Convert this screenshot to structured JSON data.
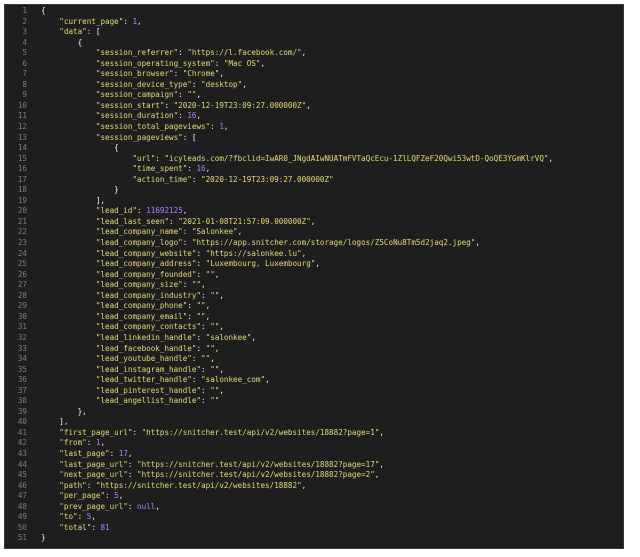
{
  "editor": {
    "lines": [
      [
        [
          "p",
          "{"
        ]
      ],
      [
        [
          "p",
          "    "
        ],
        [
          "k",
          "\"current_page\""
        ],
        [
          "p",
          ": "
        ],
        [
          "n",
          "1"
        ],
        [
          "p",
          ","
        ]
      ],
      [
        [
          "p",
          "    "
        ],
        [
          "k",
          "\"data\""
        ],
        [
          "p",
          ": ["
        ]
      ],
      [
        [
          "p",
          "        {"
        ]
      ],
      [
        [
          "p",
          "            "
        ],
        [
          "k",
          "\"session_referrer\""
        ],
        [
          "p",
          ": "
        ],
        [
          "s",
          "\"https://l.facebook.com/\""
        ],
        [
          "p",
          ","
        ]
      ],
      [
        [
          "p",
          "            "
        ],
        [
          "k",
          "\"session_operating_system\""
        ],
        [
          "p",
          ": "
        ],
        [
          "s",
          "\"Mac OS\""
        ],
        [
          "p",
          ","
        ]
      ],
      [
        [
          "p",
          "            "
        ],
        [
          "k",
          "\"session_browser\""
        ],
        [
          "p",
          ": "
        ],
        [
          "s",
          "\"Chrome\""
        ],
        [
          "p",
          ","
        ]
      ],
      [
        [
          "p",
          "            "
        ],
        [
          "k",
          "\"session_device_type\""
        ],
        [
          "p",
          ": "
        ],
        [
          "s",
          "\"desktop\""
        ],
        [
          "p",
          ","
        ]
      ],
      [
        [
          "p",
          "            "
        ],
        [
          "k",
          "\"session_campaign\""
        ],
        [
          "p",
          ": "
        ],
        [
          "s",
          "\"\""
        ],
        [
          "p",
          ","
        ]
      ],
      [
        [
          "p",
          "            "
        ],
        [
          "k",
          "\"session_start\""
        ],
        [
          "p",
          ": "
        ],
        [
          "s",
          "\"2020-12-19T23:09:27.000000Z\""
        ],
        [
          "p",
          ","
        ]
      ],
      [
        [
          "p",
          "            "
        ],
        [
          "k",
          "\"session_duration\""
        ],
        [
          "p",
          ": "
        ],
        [
          "n",
          "16"
        ],
        [
          "p",
          ","
        ]
      ],
      [
        [
          "p",
          "            "
        ],
        [
          "k",
          "\"session_total_pageviews\""
        ],
        [
          "p",
          ": "
        ],
        [
          "n",
          "1"
        ],
        [
          "p",
          ","
        ]
      ],
      [
        [
          "p",
          "            "
        ],
        [
          "k",
          "\"session_pageviews\""
        ],
        [
          "p",
          ": ["
        ]
      ],
      [
        [
          "p",
          "                {"
        ]
      ],
      [
        [
          "p",
          "                    "
        ],
        [
          "k",
          "\"url\""
        ],
        [
          "p",
          ": "
        ],
        [
          "s",
          "\"icyleads.com/?fbclid=IwAR0_JNgdAIwNUATmFVTaQcEcu-1ZlLQFZeF20Qwi53wtD-QoQE3YGmKlrVQ\""
        ],
        [
          "p",
          ","
        ]
      ],
      [
        [
          "p",
          "                    "
        ],
        [
          "k",
          "\"time_spent\""
        ],
        [
          "p",
          ": "
        ],
        [
          "n",
          "16"
        ],
        [
          "p",
          ","
        ]
      ],
      [
        [
          "p",
          "                    "
        ],
        [
          "k",
          "\"action_time\""
        ],
        [
          "p",
          ": "
        ],
        [
          "s",
          "\"2020-12-19T23:09:27.000000Z\""
        ]
      ],
      [
        [
          "p",
          "                }"
        ]
      ],
      [
        [
          "p",
          "            ],"
        ]
      ],
      [
        [
          "p",
          "            "
        ],
        [
          "k",
          "\"lead_id\""
        ],
        [
          "p",
          ": "
        ],
        [
          "n",
          "11692125"
        ],
        [
          "p",
          ","
        ]
      ],
      [
        [
          "p",
          "            "
        ],
        [
          "k",
          "\"lead_last_seen\""
        ],
        [
          "p",
          ": "
        ],
        [
          "s",
          "\"2021-01-08T21:57:09.000000Z\""
        ],
        [
          "p",
          ","
        ]
      ],
      [
        [
          "p",
          "            "
        ],
        [
          "k",
          "\"lead_company_name\""
        ],
        [
          "p",
          ": "
        ],
        [
          "s",
          "\"Salonkee\""
        ],
        [
          "p",
          ","
        ]
      ],
      [
        [
          "p",
          "            "
        ],
        [
          "k",
          "\"lead_company_logo\""
        ],
        [
          "p",
          ": "
        ],
        [
          "s",
          "\"https://app.snitcher.com/storage/logos/Z5CoNu8Tm5d2jaq2.jpeg\""
        ],
        [
          "p",
          ","
        ]
      ],
      [
        [
          "p",
          "            "
        ],
        [
          "k",
          "\"lead_company_website\""
        ],
        [
          "p",
          ": "
        ],
        [
          "s",
          "\"https://salonkee.lu\""
        ],
        [
          "p",
          ","
        ]
      ],
      [
        [
          "p",
          "            "
        ],
        [
          "k",
          "\"lead_company_address\""
        ],
        [
          "p",
          ": "
        ],
        [
          "s",
          "\"Luxembourg, Luxembourg\""
        ],
        [
          "p",
          ","
        ]
      ],
      [
        [
          "p",
          "            "
        ],
        [
          "k",
          "\"lead_company_founded\""
        ],
        [
          "p",
          ": "
        ],
        [
          "s",
          "\"\""
        ],
        [
          "p",
          ","
        ]
      ],
      [
        [
          "p",
          "            "
        ],
        [
          "k",
          "\"lead_company_size\""
        ],
        [
          "p",
          ": "
        ],
        [
          "s",
          "\"\""
        ],
        [
          "p",
          ","
        ]
      ],
      [
        [
          "p",
          "            "
        ],
        [
          "k",
          "\"lead_company_industry\""
        ],
        [
          "p",
          ": "
        ],
        [
          "s",
          "\"\""
        ],
        [
          "p",
          ","
        ]
      ],
      [
        [
          "p",
          "            "
        ],
        [
          "k",
          "\"lead_company_phone\""
        ],
        [
          "p",
          ": "
        ],
        [
          "s",
          "\"\""
        ],
        [
          "p",
          ","
        ]
      ],
      [
        [
          "p",
          "            "
        ],
        [
          "k",
          "\"lead_company_email\""
        ],
        [
          "p",
          ": "
        ],
        [
          "s",
          "\"\""
        ],
        [
          "p",
          ","
        ]
      ],
      [
        [
          "p",
          "            "
        ],
        [
          "k",
          "\"lead_company_contacts\""
        ],
        [
          "p",
          ": "
        ],
        [
          "s",
          "\"\""
        ],
        [
          "p",
          ","
        ]
      ],
      [
        [
          "p",
          "            "
        ],
        [
          "k",
          "\"lead_linkedin_handle\""
        ],
        [
          "p",
          ": "
        ],
        [
          "s",
          "\"salonkee\""
        ],
        [
          "p",
          ","
        ]
      ],
      [
        [
          "p",
          "            "
        ],
        [
          "k",
          "\"lead_facebook_handle\""
        ],
        [
          "p",
          ": "
        ],
        [
          "s",
          "\"\""
        ],
        [
          "p",
          ","
        ]
      ],
      [
        [
          "p",
          "            "
        ],
        [
          "k",
          "\"lead_youtube_handle\""
        ],
        [
          "p",
          ": "
        ],
        [
          "s",
          "\"\""
        ],
        [
          "p",
          ","
        ]
      ],
      [
        [
          "p",
          "            "
        ],
        [
          "k",
          "\"lead_instagram_handle\""
        ],
        [
          "p",
          ": "
        ],
        [
          "s",
          "\"\""
        ],
        [
          "p",
          ","
        ]
      ],
      [
        [
          "p",
          "            "
        ],
        [
          "k",
          "\"lead_twitter_handle\""
        ],
        [
          "p",
          ": "
        ],
        [
          "s",
          "\"salonkee_com\""
        ],
        [
          "p",
          ","
        ]
      ],
      [
        [
          "p",
          "            "
        ],
        [
          "k",
          "\"lead_pinterest_handle\""
        ],
        [
          "p",
          ": "
        ],
        [
          "s",
          "\"\""
        ],
        [
          "p",
          ","
        ]
      ],
      [
        [
          "p",
          "            "
        ],
        [
          "k",
          "\"lead_angellist_handle\""
        ],
        [
          "p",
          ": "
        ],
        [
          "s",
          "\"\""
        ]
      ],
      [
        [
          "p",
          "        },"
        ]
      ],
      [
        [
          "p",
          "    ],"
        ]
      ],
      [
        [
          "p",
          "    "
        ],
        [
          "k",
          "\"first_page_url\""
        ],
        [
          "p",
          ": "
        ],
        [
          "s",
          "\"https://snitcher.test/api/v2/websites/18882?page=1\""
        ],
        [
          "p",
          ","
        ]
      ],
      [
        [
          "p",
          "    "
        ],
        [
          "k",
          "\"from\""
        ],
        [
          "p",
          ": "
        ],
        [
          "n",
          "1"
        ],
        [
          "p",
          ","
        ]
      ],
      [
        [
          "p",
          "    "
        ],
        [
          "k",
          "\"last_page\""
        ],
        [
          "p",
          ": "
        ],
        [
          "n",
          "17"
        ],
        [
          "p",
          ","
        ]
      ],
      [
        [
          "p",
          "    "
        ],
        [
          "k",
          "\"last_page_url\""
        ],
        [
          "p",
          ": "
        ],
        [
          "s",
          "\"https://snitcher.test/api/v2/websites/18882?page=17\""
        ],
        [
          "p",
          ","
        ]
      ],
      [
        [
          "p",
          "    "
        ],
        [
          "k",
          "\"next_page_url\""
        ],
        [
          "p",
          ": "
        ],
        [
          "s",
          "\"https://snitcher.test/api/v2/websites/18882?page=2\""
        ],
        [
          "p",
          ","
        ]
      ],
      [
        [
          "p",
          "    "
        ],
        [
          "k",
          "\"path\""
        ],
        [
          "p",
          ": "
        ],
        [
          "s",
          "\"https://snitcher.test/api/v2/websites/18882\""
        ],
        [
          "p",
          ","
        ]
      ],
      [
        [
          "p",
          "    "
        ],
        [
          "k",
          "\"per_page\""
        ],
        [
          "p",
          ": "
        ],
        [
          "n",
          "5"
        ],
        [
          "p",
          ","
        ]
      ],
      [
        [
          "p",
          "    "
        ],
        [
          "k",
          "\"prev_page_url\""
        ],
        [
          "p",
          ": "
        ],
        [
          "l",
          "null"
        ],
        [
          "p",
          ","
        ]
      ],
      [
        [
          "p",
          "    "
        ],
        [
          "k",
          "\"to\""
        ],
        [
          "p",
          ": "
        ],
        [
          "n",
          "5"
        ],
        [
          "p",
          ","
        ]
      ],
      [
        [
          "p",
          "    "
        ],
        [
          "k",
          "\"total\""
        ],
        [
          "p",
          ": "
        ],
        [
          "n",
          "81"
        ]
      ],
      [
        [
          "p",
          "}"
        ]
      ]
    ]
  },
  "colors": {
    "background": "#1e1e1e",
    "line_number": "#7f7f7f",
    "punctuation": "#f8f8f2",
    "key": "#e6db74",
    "string": "#e6db74",
    "number": "#ae81ff"
  }
}
